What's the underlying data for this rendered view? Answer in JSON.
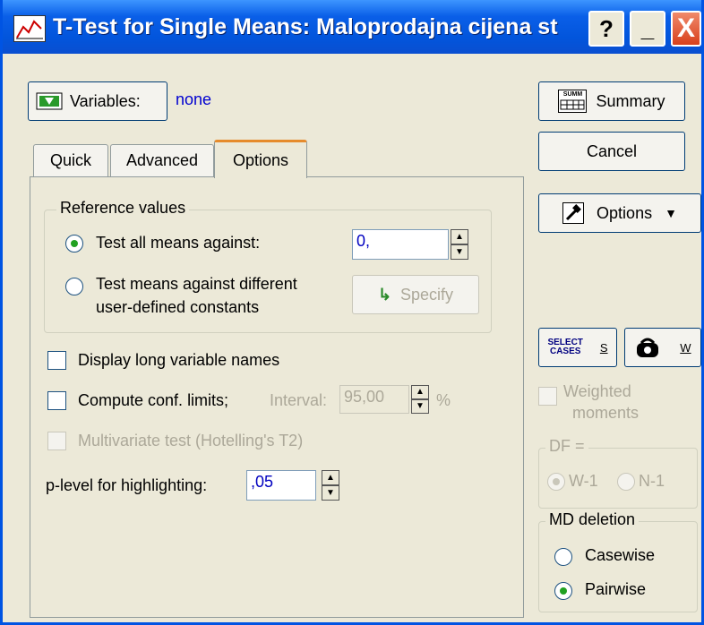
{
  "window": {
    "title": "T-Test for Single Means: Maloprodajna cijena st",
    "help_label": "?",
    "minimize_label": "_",
    "close_label": "X"
  },
  "variables": {
    "button_label": "Variables:",
    "value": "none"
  },
  "tabs": [
    {
      "label": "Quick",
      "active": false
    },
    {
      "label": "Advanced",
      "active": false
    },
    {
      "label": "Options",
      "active": true
    }
  ],
  "reference_values": {
    "legend": "Reference values",
    "test_all_label": "Test all means against:",
    "test_all_value": "0,",
    "test_diff_label_1": "Test means against different",
    "test_diff_label_2": "user-defined constants",
    "specify_label": "Specify"
  },
  "options": {
    "display_long_label": "Display long variable names",
    "compute_conf_label": "Compute conf. limits;",
    "interval_label": "Interval:",
    "interval_value": "95,00",
    "percent_label": "%",
    "multivariate_label": "Multivariate test (Hotelling's T2)",
    "plevel_label": "p-level for highlighting:",
    "plevel_value": ",05"
  },
  "right_panel": {
    "summary_label": "Summary",
    "summary_icon_text": "SUMM",
    "cancel_label": "Cancel",
    "options_label": "Options",
    "select_cases_text_1": "SELECT",
    "select_cases_text_2": "CASES",
    "select_cases_key": "S",
    "weight_key": "W",
    "weighted_moments_1": "Weighted",
    "weighted_moments_2": "moments",
    "df_legend": "DF =",
    "df_w1": "W-1",
    "df_n1": "N-1",
    "md_legend": "MD deletion",
    "casewise_label": "Casewise",
    "pairwise_label": "Pairwise"
  }
}
